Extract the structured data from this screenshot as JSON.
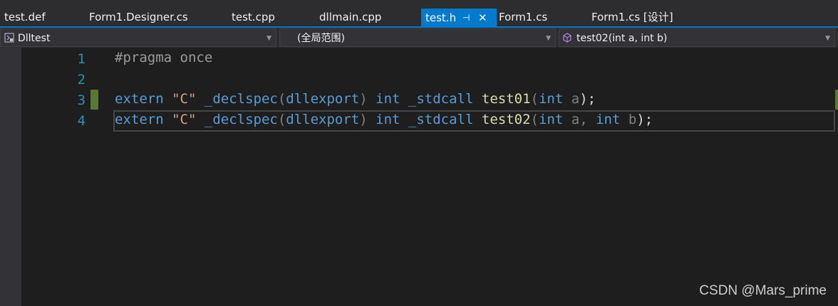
{
  "tabs": [
    {
      "label": "test.def"
    },
    {
      "label": "Form1.Designer.cs"
    },
    {
      "label": "test.cpp"
    },
    {
      "label": "dllmain.cpp"
    },
    {
      "label": "test.h",
      "active": true
    },
    {
      "label": "Form1.cs"
    },
    {
      "label": "Form1.cs [设计]"
    }
  ],
  "navbar": {
    "project": "Dlltest",
    "scope": "(全局范围)",
    "member": "test02(int a, int b)"
  },
  "editor": {
    "line_numbers": [
      "1",
      "2",
      "3",
      "4"
    ],
    "line1": {
      "directive": "#pragma once"
    },
    "line3": {
      "extern": "extern",
      "str": "\"C\"",
      "declspec": "_declspec",
      "open": "(",
      "dllexport": "dllexport",
      "close": ")",
      "int": "int",
      "stdcall": "_stdcall",
      "fn": "test01",
      "popen": "(",
      "pint": "int",
      "pa": "a",
      "end": ");"
    },
    "line4": {
      "extern": "extern",
      "str": "\"C\"",
      "declspec": "_declspec",
      "open": "(",
      "dllexport": "dllexport",
      "close": ")",
      "int": "int",
      "stdcall": "_stdcall",
      "fn": "test02",
      "popen": "(",
      "pint": "int",
      "pa": "a,",
      "pint2": "int",
      "pb": "b",
      "end": ");"
    }
  },
  "watermark": "CSDN @Mars_prime",
  "colors": {
    "accent": "#007acc",
    "keyword": "#569cd6",
    "string": "#d69d85",
    "function": "#dcdcaa",
    "line_number": "#2b91af",
    "change_marker": "#577a2e"
  }
}
